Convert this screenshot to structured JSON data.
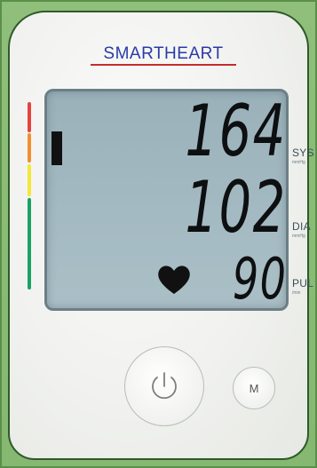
{
  "brand": {
    "name": "SMARTHEART"
  },
  "readings": {
    "systolic": {
      "value": "164",
      "label": "SYS",
      "unit": "mmHg"
    },
    "diastolic": {
      "value": "102",
      "label": "DIA",
      "unit": "mmHg"
    },
    "pulse": {
      "value": "90",
      "label": "PUL",
      "unit": "/min"
    }
  },
  "indicator_colors": [
    "#e4443f",
    "#ef9030",
    "#f2e83b",
    "#19a267"
  ],
  "icons": {
    "heart": "heart-icon",
    "power": "power-icon"
  },
  "buttons": {
    "memory_label": "M"
  }
}
